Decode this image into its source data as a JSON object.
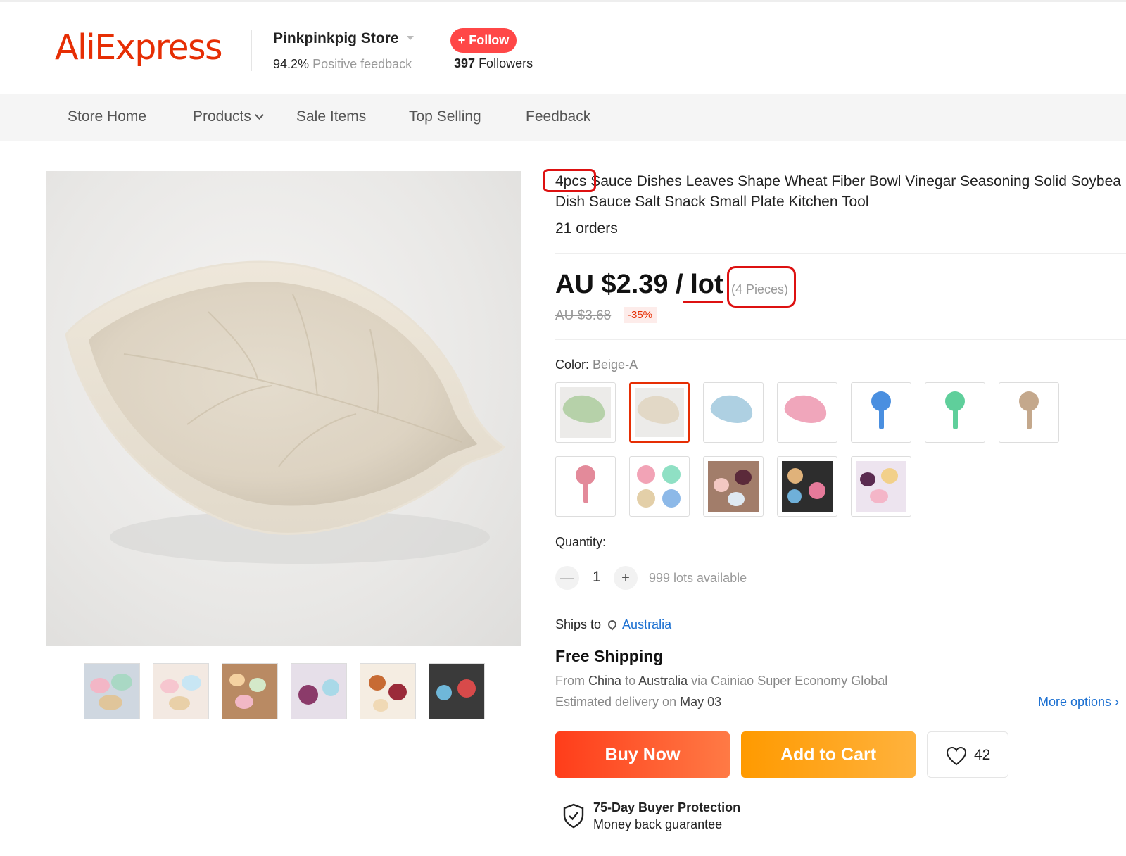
{
  "header": {
    "logo": "AliExpress",
    "store_name": "Pinkpinkpig Store",
    "feedback_pct": "94.2%",
    "feedback_label": "Positive feedback",
    "follow_label": "+ Follow",
    "followers_count": "397",
    "followers_label": "Followers"
  },
  "nav": {
    "items": [
      "Store Home",
      "Products",
      "Sale Items",
      "Top Selling",
      "Feedback"
    ]
  },
  "product": {
    "title_line1": "4pcs Sauce Dishes Leaves Shape Wheat Fiber Bowl Vinegar Seasoning Solid Soybea",
    "title_line2": "Dish Sauce Salt Snack Small Plate Kitchen Tool",
    "orders": "21 orders",
    "price": "AU $2.39 / lot",
    "pieces": "(4 Pieces)",
    "old_price": "AU $3.68",
    "discount": "-35%",
    "color_label": "Color:",
    "color_value": "Beige-A",
    "quantity_label": "Quantity:",
    "quantity_minus": "—",
    "quantity_plus": "+",
    "quantity_value": "1",
    "quantity_available": "999 lots available",
    "ships_to_label": "Ships to",
    "ships_to_country": "Australia",
    "shipping_title": "Free Shipping",
    "ship_from_prefix": "From",
    "ship_from_origin": "China",
    "ship_from_to": "to",
    "ship_from_dest": "Australia",
    "ship_from_via": "via Cainiao Super Economy Global",
    "ship_est_prefix": "Estimated delivery on",
    "ship_est_date": "May 03",
    "more_options": "More options ›",
    "buy_now": "Buy Now",
    "add_to_cart": "Add to Cart",
    "wishlist_count": "42",
    "protection_title": "75-Day Buyer Protection",
    "protection_sub": "Money back guarantee"
  },
  "colors": {
    "accent": "#e62e04",
    "follow": "#ff4747",
    "link": "#1a6fd1",
    "annotation": "#dd1111"
  }
}
